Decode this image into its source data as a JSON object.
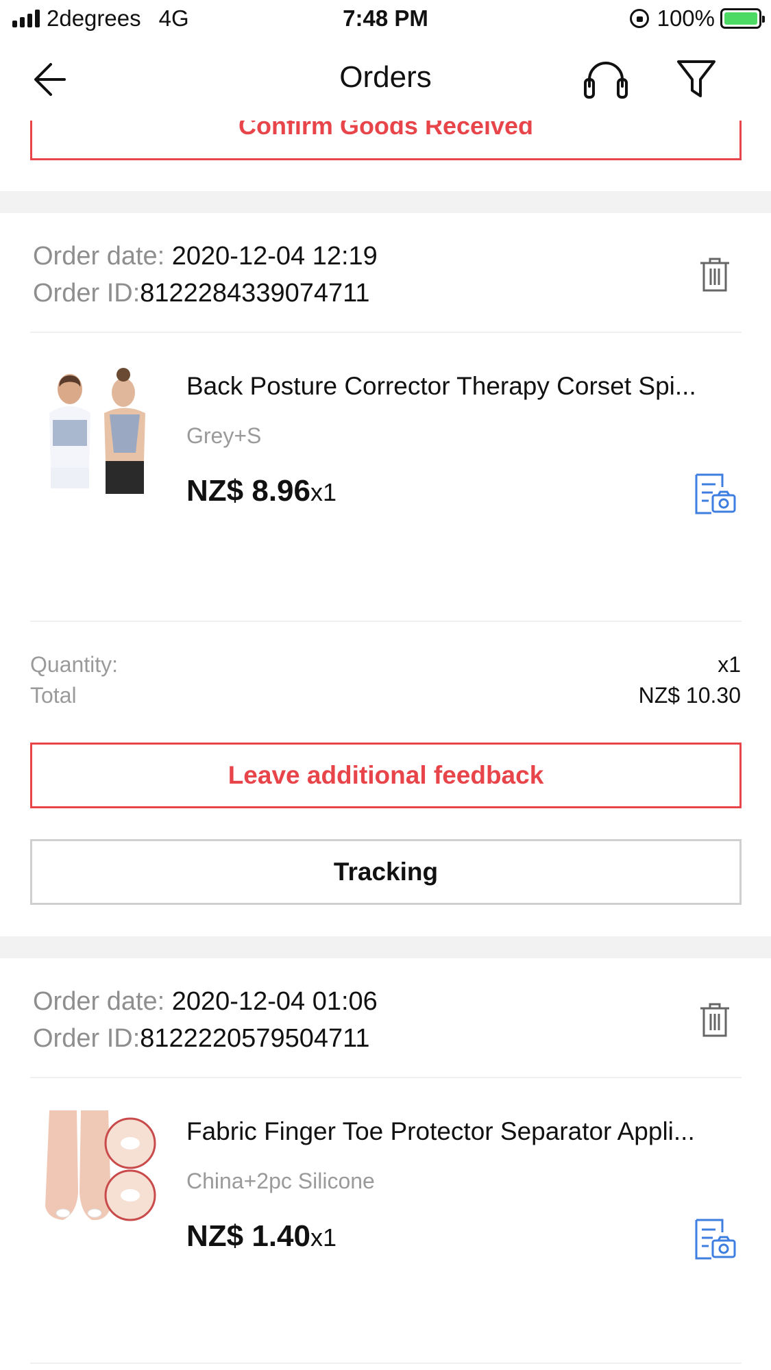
{
  "status_bar": {
    "carrier": "2degrees",
    "network": "4G",
    "time": "7:48 PM",
    "battery": "100%",
    "battery_color": "#4cd964"
  },
  "nav": {
    "title": "Orders",
    "back_icon": "arrow-left-icon",
    "support_icon": "headset-icon",
    "filter_icon": "filter-icon"
  },
  "confirm_button": {
    "label": "Confirm Goods Received"
  },
  "accent_color": "#e8454b",
  "orders": [
    {
      "date_label": "Order date: ",
      "date": "2020-12-04 12:19",
      "id_label": "Order ID:",
      "id": "8122284339074711",
      "product": {
        "title": "Back Posture Corrector Therapy Corset Spi...",
        "variant": "Grey+S",
        "price": "NZ$ 8.96",
        "qty": "x1"
      },
      "summary": {
        "quantity_label": "Quantity:",
        "quantity_value": "x1",
        "total_label": "Total",
        "total_value": "NZ$ 10.30"
      },
      "buttons": {
        "feedback": "Leave additional feedback",
        "tracking": "Tracking"
      }
    },
    {
      "date_label": "Order date: ",
      "date": "2020-12-04 01:06",
      "id_label": "Order ID:",
      "id": "8122220579504711",
      "product": {
        "title": "Fabric Finger Toe Protector Separator Appli...",
        "variant": "China+2pc Silicone",
        "price": "NZ$ 1.40",
        "qty": "x1"
      }
    }
  ]
}
